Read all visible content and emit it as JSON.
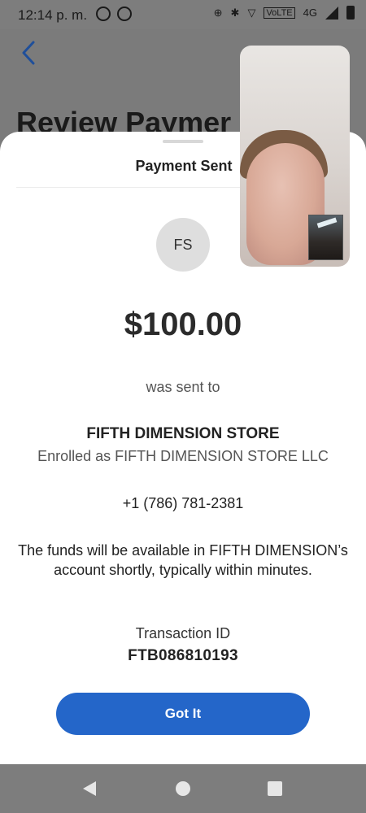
{
  "status_bar": {
    "time": "12:14 p. m.",
    "network": "4G",
    "volte": "VoLTE",
    "left_icons": [
      "whatsapp-icon",
      "messenger-icon"
    ],
    "right_icons": [
      "data-saver-icon",
      "bluetooth-icon",
      "wifi-icon",
      "signal-icon",
      "battery-icon"
    ]
  },
  "background_screen": {
    "title": "Review Paymer",
    "back_icon": "chevron-left-icon",
    "accent_color": "#1f4f9a"
  },
  "sheet": {
    "title": "Payment Sent",
    "avatar_initials": "FS",
    "amount": "$100.00",
    "sent_to_label": "was sent to",
    "recipient_name": "FIFTH DIMENSION STORE",
    "enrolled_as": "Enrolled as FIFTH DIMENSION STORE LLC",
    "phone": "+1 (786) 781-2381",
    "funds_note": "The funds will be available in FIFTH DIMENSION’s account shortly, typically within minutes.",
    "transaction_label": "Transaction ID",
    "transaction_id": "FTB086810193",
    "button_label": "Got It",
    "button_color": "#2466c9"
  },
  "nav_bar": {
    "icons": [
      "back-triangle-icon",
      "home-circle-icon",
      "recents-square-icon"
    ]
  }
}
